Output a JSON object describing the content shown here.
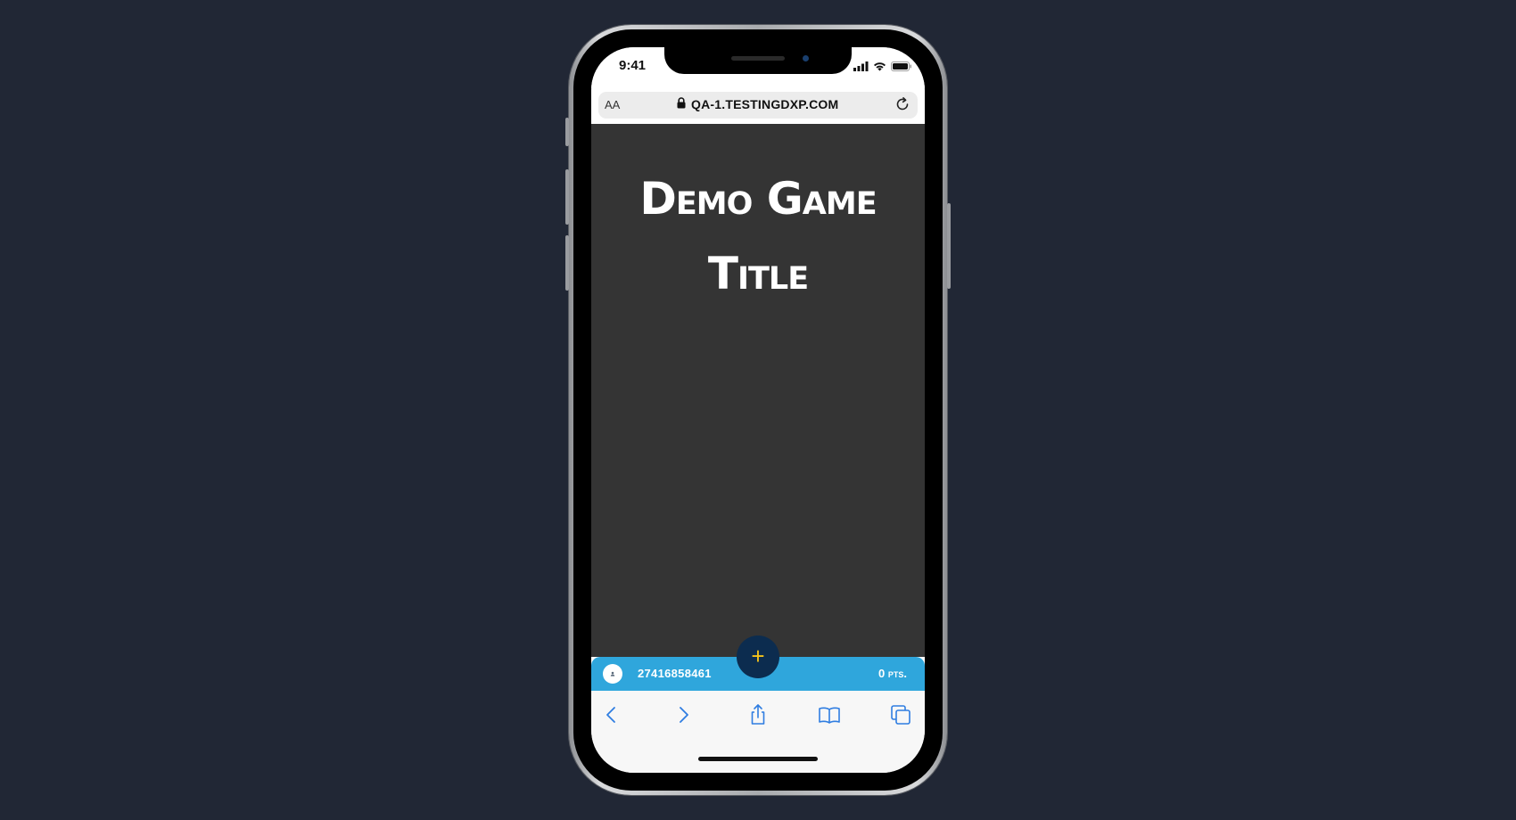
{
  "status_bar": {
    "time": "9:41",
    "icons": [
      "signal-icon",
      "wifi-icon",
      "battery-icon"
    ]
  },
  "address_bar": {
    "text_size_label": "AA",
    "url": "QA-1.TESTINGDXP.COM",
    "icons": [
      "lock-icon",
      "reload-icon"
    ]
  },
  "game": {
    "title_line1": "Demo Game",
    "title_line2": "Title"
  },
  "game_bar": {
    "player_id": "27416858461",
    "points": "0 pts.",
    "fab_label": "+",
    "colors": {
      "bar": "#2fa6dc",
      "fab": "#0c2c4f",
      "fab_icon": "#f4c21a"
    }
  },
  "toolbar": {
    "buttons": [
      "back-icon",
      "forward-icon",
      "share-icon",
      "bookmarks-icon",
      "tabs-icon"
    ],
    "accent": "#2f7de1"
  },
  "colors": {
    "background": "#212735",
    "content": "#343434"
  }
}
